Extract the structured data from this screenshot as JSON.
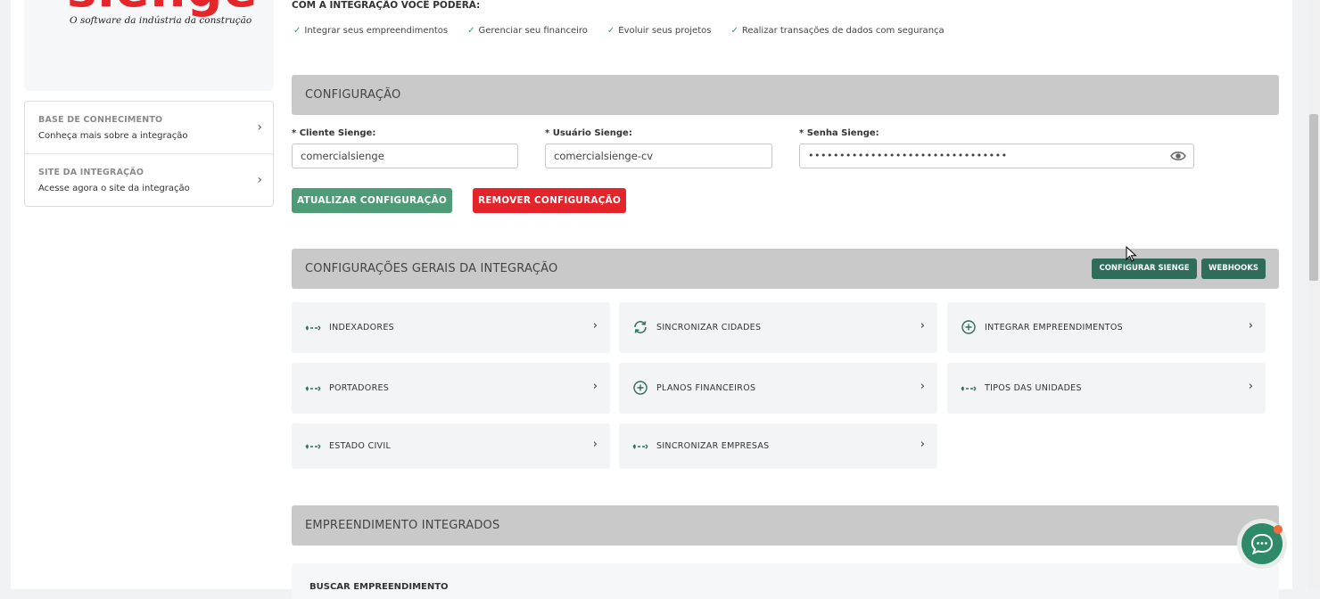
{
  "sidebar": {
    "logo_text": "sienge",
    "logo_tagline": "O software da indústria da construção",
    "links": [
      {
        "title": "BASE DE CONHECIMENTO",
        "subtitle": "Conheça mais sobre a integração"
      },
      {
        "title": "SITE DA INTEGRAÇÃO",
        "subtitle": "Acesse agora o site da integração"
      }
    ]
  },
  "intro": {
    "title": "COM A INTEGRAÇÃO VOCÊ PODERÁ:",
    "benefits": [
      "Integrar seus empreendimentos",
      "Gerenciar seu financeiro",
      "Evoluir seus projetos",
      "Realizar transações de dados com segurança"
    ]
  },
  "config": {
    "section_title": "CONFIGURAÇÃO",
    "cliente_label": "* Cliente Sienge:",
    "cliente_value": "comercialsienge",
    "usuario_label": "* Usuário Sienge:",
    "usuario_value": "comercialsienge-cv",
    "senha_label": "* Senha Sienge:",
    "senha_value": "••••••••••••••••••••••••••••••••",
    "update_button": "ATUALIZAR CONFIGURAÇÃO",
    "remove_button": "REMOVER CONFIGURAÇÃO"
  },
  "general": {
    "section_title": "CONFIGURAÇÕES GERAIS DA INTEGRAÇÃO",
    "configure_button": "CONFIGURAR SIENGE",
    "webhooks_button": "WEBHOOKS",
    "options": [
      {
        "label": "INDEXADORES",
        "icon": "arrows-horizontal-icon"
      },
      {
        "label": "SINCRONIZAR CIDADES",
        "icon": "sync-icon"
      },
      {
        "label": "INTEGRAR EMPREENDIMENTOS",
        "icon": "plus-circle-icon"
      },
      {
        "label": "PORTADORES",
        "icon": "arrows-horizontal-icon"
      },
      {
        "label": "PLANOS FINANCEIROS",
        "icon": "plus-circle-icon"
      },
      {
        "label": "TIPOS DAS UNIDADES",
        "icon": "arrows-horizontal-icon"
      },
      {
        "label": "ESTADO CIVIL",
        "icon": "arrows-horizontal-icon"
      },
      {
        "label": "SINCRONIZAR EMPRESAS",
        "icon": "arrows-horizontal-icon"
      }
    ]
  },
  "integrated": {
    "section_title": "EMPREENDIMENTO INTEGRADOS",
    "search_label": "BUSCAR EMPREENDIMENTO"
  },
  "colors": {
    "accent_green": "#4e9b78",
    "danger_red": "#e3242b",
    "dark_green": "#2f6d5a",
    "brand_red": "#e4262c"
  }
}
